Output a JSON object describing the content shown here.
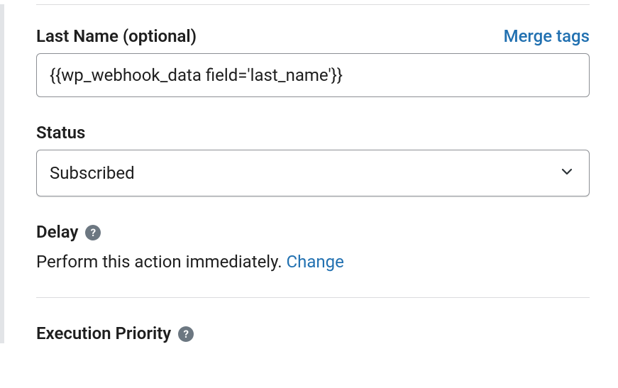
{
  "lastName": {
    "label": "Last Name (optional)",
    "mergeTags": "Merge tags",
    "value": "{{wp_webhook_data field='last_name'}}"
  },
  "status": {
    "label": "Status",
    "selected": "Subscribed"
  },
  "delay": {
    "label": "Delay",
    "text": "Perform this action immediately. ",
    "change": "Change"
  },
  "executionPriority": {
    "label": "Execution Priority"
  },
  "helpGlyph": "?"
}
